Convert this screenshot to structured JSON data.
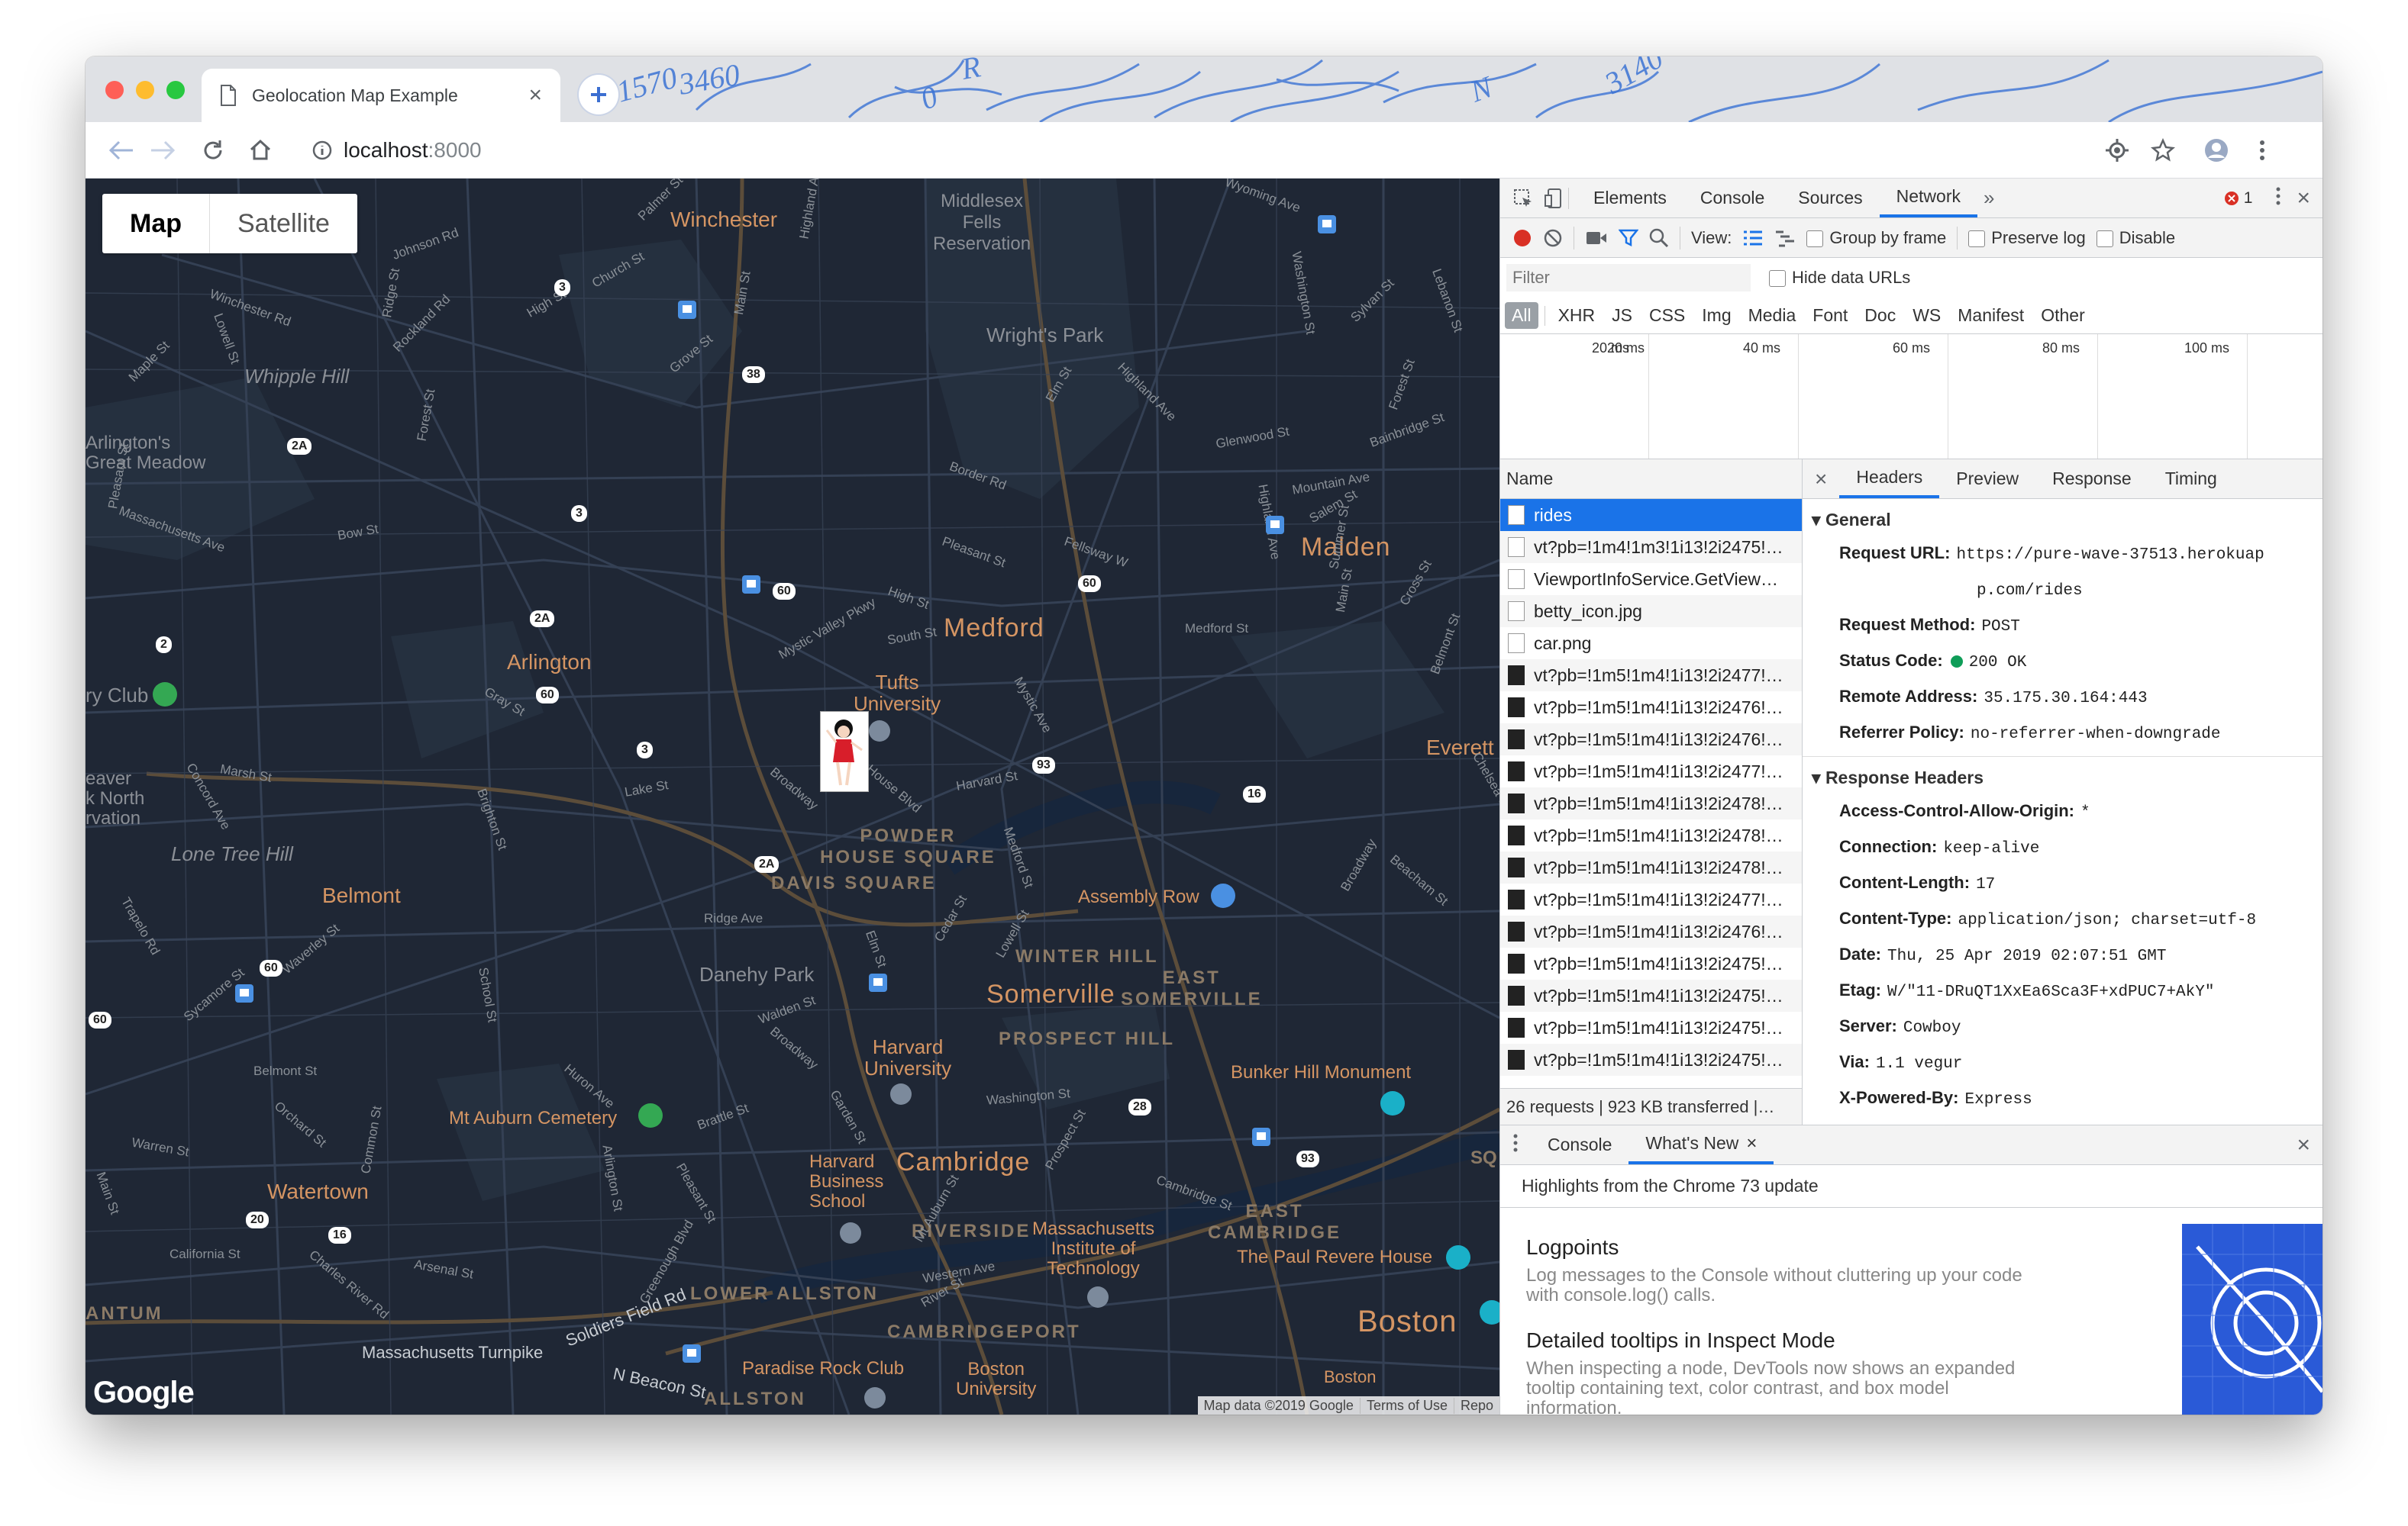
{
  "browser": {
    "tab_title": "Geolocation Map Example",
    "url_host": "localhost",
    "url_port": ":8000"
  },
  "map": {
    "map_type": [
      "Map",
      "Satellite"
    ],
    "labels": {
      "winchester": "Winchester",
      "middlesex": "Middlesex\nFells\nReservation",
      "wrights_park": "Wright's Park",
      "whipple_hill": "Whipple Hill",
      "arlingtons_meadow": "Arlington's\nGreat Meadow",
      "malden": "Malden",
      "medford": "Medford",
      "arlington": "Arlington",
      "tufts": "Tufts\nUniversity",
      "everett": "Everett",
      "ry_club": "ry Club",
      "beaver": "eaver\nk North\nrvation",
      "lone_tree": "Lone Tree Hill",
      "belmont": "Belmont",
      "powder_house": "POWDER\nHOUSE SQUARE",
      "davis": "DAVIS SQUARE",
      "assembly_row": "Assembly Row",
      "danehy": "Danehy Park",
      "winter_hill": "WINTER HILL",
      "east_somerville": "EAST\nSOMERVILLE",
      "somerville": "Somerville",
      "prospect_hill": "PROSPECT HILL",
      "harvard": "Harvard\nUniversity",
      "bunker_hill": "Bunker Hill Monument",
      "mt_auburn": "Mt Auburn Cemetery",
      "watertown": "Watertown",
      "harvard_bs": "Harvard\nBusiness\nSchool",
      "cambridge": "Cambridge",
      "east_cambridge": "EAST\nCAMBRIDGE",
      "riverside": "RIVERSIDE",
      "mit": "Massachusetts\nInstitute of\nTechnology",
      "paul_revere": "The Paul Revere House",
      "lower_allston": "LOWER ALLSTON",
      "cambridgeport": "CAMBRIDGEPORT",
      "boston": "Boston",
      "antum": "ANTUM",
      "mass_turnpike": "Massachusetts Turnpike",
      "soldiers_field": "Soldiers Field Rd",
      "paradise_rock": "Paradise Rock Club",
      "n_beacon": "N Beacon St",
      "allston": "ALLSTON",
      "boston_univ": "Boston\nUniversity",
      "boston_small": "Boston",
      "sq": "SQ"
    },
    "streets": [
      "Wyoming Ave",
      "Palmer St",
      "Highland Ave",
      "Johnson Rd",
      "Church St",
      "High St",
      "Winchester Rd",
      "Lowell St",
      "Ridge St",
      "Rockland Rd",
      "Grove St",
      "Main St",
      "Elm St",
      "Highland Ave",
      "Sylvan St",
      "Forest St",
      "Washington St",
      "Lebanon St",
      "Maple St",
      "Bainbridge St",
      "Pleasant St",
      "Forest St",
      "Glenwood St",
      "Border Rd",
      "Mountain Ave",
      "Salem St",
      "Massachusetts Ave",
      "Bow St",
      "Summer St",
      "Fellsway W",
      "Pleasant St",
      "High St",
      "Mystic Valley Pkwy",
      "South St",
      "Medford St",
      "Highland Ave",
      "Main St",
      "Cross St",
      "Belmont St",
      "Gray St",
      "Mystic Ave",
      "Harvard St",
      "Powder House Blvd",
      "Broadway",
      "Lake St",
      "Marsh St",
      "Concord Ave",
      "Brighton St",
      "Chelsea St",
      "Broadway",
      "Beacham St",
      "Ridge Ave",
      "Elm St",
      "Cedar St",
      "Lowell St",
      "Medford St",
      "Trapelo Rd",
      "Waverley St",
      "Sycamore St",
      "School St",
      "Walden St",
      "Broadway",
      "Huron Ave",
      "Brattle St",
      "Washington St",
      "Garden St",
      "Belmont St",
      "Orchard St",
      "Common St",
      "Mt Auburn St",
      "Cambridge St",
      "Prospect St",
      "Warren St",
      "Arlington St",
      "Pleasant St",
      "Main St",
      "California St",
      "Arsenal St",
      "Charles River Rd",
      "Greenough Blvd",
      "Western Ave",
      "River St"
    ],
    "highways": [
      "3",
      "38",
      "2A",
      "3",
      "60",
      "60",
      "2A",
      "60",
      "60",
      "3",
      "93",
      "16",
      "2A",
      "60",
      "60",
      "2",
      "16",
      "28",
      "93",
      "20",
      "16"
    ],
    "attribution": [
      "Map data ©2019 Google",
      "Terms of Use",
      "Repo"
    ],
    "google_logo": "Google"
  },
  "devtools": {
    "tabs": [
      "Elements",
      "Console",
      "Sources",
      "Network"
    ],
    "error_count": "1",
    "toolbar": {
      "view_label": "View:",
      "group_by_frame": "Group by frame",
      "preserve_log": "Preserve log",
      "disable_cache": "Disable"
    },
    "filter_placeholder": "Filter",
    "hide_data_urls": "Hide data URLs",
    "filter_types": [
      "All",
      "XHR",
      "JS",
      "CSS",
      "Img",
      "Media",
      "Font",
      "Doc",
      "WS",
      "Manifest",
      "Other"
    ],
    "timeline": [
      "20 ms",
      "40 ms",
      "60 ms",
      "80 ms",
      "100 ms"
    ],
    "name_header": "Name",
    "requests": [
      {
        "name": "rides",
        "icon": "doc"
      },
      {
        "name": "vt?pb=!1m4!1m3!1i13!2i2475!…",
        "icon": "doc"
      },
      {
        "name": "ViewportInfoService.GetView…",
        "icon": "doc"
      },
      {
        "name": "betty_icon.jpg",
        "icon": "img"
      },
      {
        "name": "car.png",
        "icon": "img"
      },
      {
        "name": "vt?pb=!1m5!1m4!1i13!2i2477!…",
        "icon": "dark"
      },
      {
        "name": "vt?pb=!1m5!1m4!1i13!2i2476!…",
        "icon": "dark"
      },
      {
        "name": "vt?pb=!1m5!1m4!1i13!2i2476!…",
        "icon": "dark"
      },
      {
        "name": "vt?pb=!1m5!1m4!1i13!2i2477!…",
        "icon": "dark"
      },
      {
        "name": "vt?pb=!1m5!1m4!1i13!2i2478!…",
        "icon": "dark"
      },
      {
        "name": "vt?pb=!1m5!1m4!1i13!2i2478!…",
        "icon": "dark"
      },
      {
        "name": "vt?pb=!1m5!1m4!1i13!2i2478!…",
        "icon": "dark"
      },
      {
        "name": "vt?pb=!1m5!1m4!1i13!2i2477!…",
        "icon": "dark"
      },
      {
        "name": "vt?pb=!1m5!1m4!1i13!2i2476!…",
        "icon": "dark"
      },
      {
        "name": "vt?pb=!1m5!1m4!1i13!2i2475!…",
        "icon": "dark"
      },
      {
        "name": "vt?pb=!1m5!1m4!1i13!2i2475!…",
        "icon": "dark"
      },
      {
        "name": "vt?pb=!1m5!1m4!1i13!2i2475!…",
        "icon": "dark"
      },
      {
        "name": "vt?pb=!1m5!1m4!1i13!2i2475!…",
        "icon": "dark"
      }
    ],
    "summary": "26 requests | 923 KB transferred |…",
    "detail_tabs": [
      "Headers",
      "Preview",
      "Response",
      "Timing"
    ],
    "general_title": "General",
    "general": [
      {
        "k": "Request URL:",
        "v": "https://pure-wave-37513.herokuap"
      },
      {
        "k": "",
        "v": "p.com/rides"
      },
      {
        "k": "Request Method:",
        "v": "POST"
      },
      {
        "k": "Status Code:",
        "v": "200 OK"
      },
      {
        "k": "Remote Address:",
        "v": "35.175.30.164:443"
      },
      {
        "k": "Referrer Policy:",
        "v": "no-referrer-when-downgrade"
      }
    ],
    "response_title": "Response Headers",
    "response_headers": [
      {
        "k": "Access-Control-Allow-Origin:",
        "v": "*"
      },
      {
        "k": "Connection:",
        "v": "keep-alive"
      },
      {
        "k": "Content-Length:",
        "v": "17"
      },
      {
        "k": "Content-Type:",
        "v": "application/json; charset=utf-8"
      },
      {
        "k": "Date:",
        "v": "Thu, 25 Apr 2019 02:07:51 GMT"
      },
      {
        "k": "Etag:",
        "v": "W/\"11-DRuQT1XxEa6Sca3F+xdPUC7+AkY\""
      },
      {
        "k": "Server:",
        "v": "Cowboy"
      },
      {
        "k": "Via:",
        "v": "1.1 vegur"
      },
      {
        "k": "X-Powered-By:",
        "v": "Express"
      }
    ],
    "drawer": {
      "tabs": [
        "Console",
        "What's New"
      ],
      "highlights": "Highlights from the Chrome 73 update",
      "items": [
        {
          "title": "Logpoints",
          "desc": "Log messages to the Console without cluttering up your code\nwith console.log() calls."
        },
        {
          "title": "Detailed tooltips in Inspect Mode",
          "desc": "When inspecting a node, DevTools now shows an expanded\ntooltip containing text, color contrast, and box model\ninformation."
        }
      ]
    },
    "colors": {
      "accent": "#1a73e8",
      "status_ok": "#0f9d58",
      "record": "#d93025"
    }
  }
}
